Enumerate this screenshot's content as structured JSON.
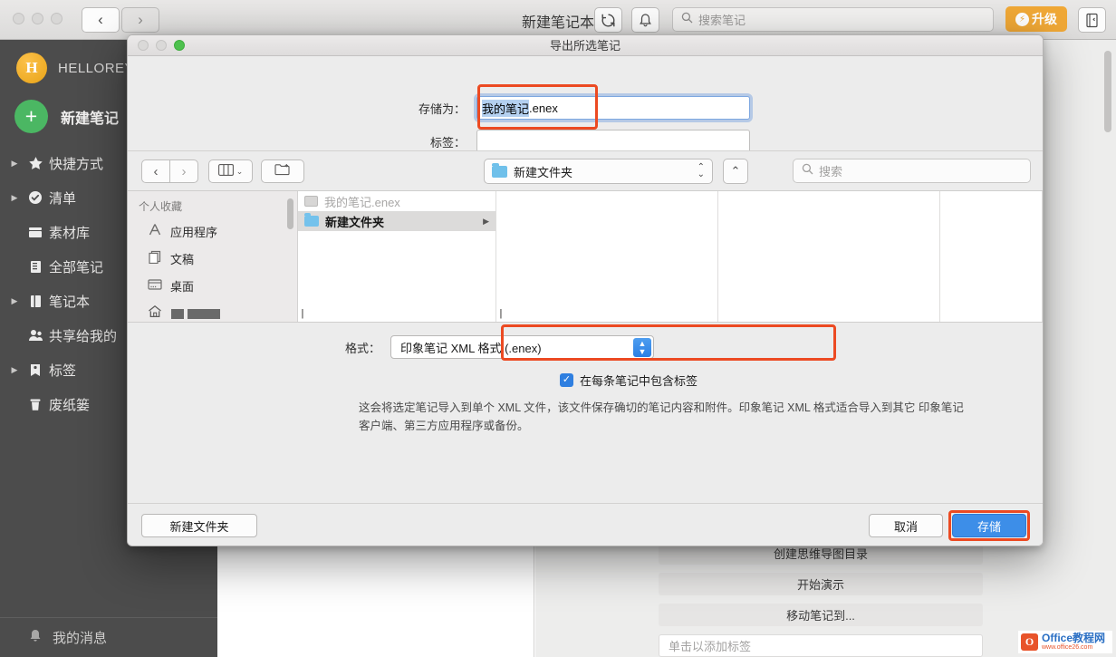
{
  "app": {
    "title": "新建笔记本",
    "nav": {
      "back": "‹",
      "forward": "›"
    },
    "toolbar": {
      "sync_icon": "sync-icon",
      "bell_icon": "bell-icon",
      "note_icon": "note-icon",
      "search_placeholder": "搜索笔记",
      "upgrade_label": "升级"
    },
    "sidebar": {
      "account_initial": "H",
      "account_name": "HELLOREY",
      "new_note_label": "新建笔记",
      "items": [
        {
          "label": "快捷方式",
          "icon": "star-icon",
          "expandable": true
        },
        {
          "label": "清单",
          "icon": "check-circle-icon",
          "expandable": true
        },
        {
          "label": "素材库",
          "icon": "library-icon",
          "expandable": false
        },
        {
          "label": "全部笔记",
          "icon": "all-notes-icon",
          "expandable": false
        },
        {
          "label": "笔记本",
          "icon": "notebook-icon",
          "expandable": true
        },
        {
          "label": "共享给我的",
          "icon": "shared-icon",
          "expandable": false
        },
        {
          "label": "标签",
          "icon": "tag-icon",
          "expandable": true
        },
        {
          "label": "废纸篓",
          "icon": "trash-icon",
          "expandable": false
        }
      ],
      "messages_label": "我的消息"
    },
    "context_menu": [
      "创建思维导图目录",
      "开始演示",
      "移动笔记到..."
    ],
    "tag_field_placeholder": "单击以添加标签"
  },
  "dialog": {
    "title": "导出所选笔记",
    "save_as": {
      "label": "存储为：",
      "value_selected": "我的笔记",
      "value_rest": ".enex"
    },
    "tags": {
      "label": "标签：",
      "value": ""
    },
    "browser": {
      "back": "‹",
      "forward": "›",
      "view_icon": "column-view-icon",
      "view_caret": "⌄",
      "new_folder_icon": "new-folder-icon",
      "path_name": "新建文件夹",
      "path_caret_up": "⌃",
      "path_caret_down": "⌄",
      "up_button": "⌃",
      "search_placeholder": "搜索",
      "favorites_header": "个人收藏",
      "favorites": [
        {
          "label": "应用程序",
          "icon": "applications-icon"
        },
        {
          "label": "文稿",
          "icon": "documents-icon"
        },
        {
          "label": "桌面",
          "icon": "desktop-icon"
        },
        {
          "label": "",
          "icon": "home-icon",
          "redacted": true
        }
      ],
      "files": [
        {
          "name": "我的笔记.enex",
          "type": "file",
          "state": "dimmed"
        },
        {
          "name": "新建文件夹",
          "type": "folder",
          "state": "selected"
        }
      ]
    },
    "format": {
      "label": "格式：",
      "value": "印象笔记 XML 格式 (.enex)",
      "checkbox_label": "在每条笔记中包含标签",
      "checkbox_checked": true,
      "description": "这会将选定笔记导入到单个 XML 文件，该文件保存确切的笔记内容和附件。印象笔记 XML 格式适合导入到其它 印象笔记 客户端、第三方应用程序或备份。"
    },
    "footer": {
      "new_folder_label": "新建文件夹",
      "cancel_label": "取消",
      "save_label": "存储"
    },
    "highlight_color": "#ec4a22"
  },
  "watermark": {
    "brand": "Office教程网",
    "url": "www.office26.com",
    "mark": "O"
  }
}
